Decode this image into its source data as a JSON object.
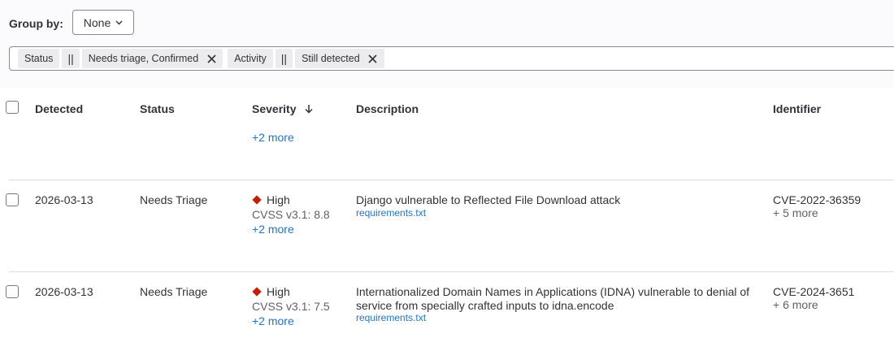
{
  "group_by": {
    "label": "Group by:",
    "value": "None"
  },
  "filters": {
    "tokens": [
      {
        "key": "Status",
        "operator": "||",
        "value": "Needs triage, Confirmed"
      },
      {
        "key": "Activity",
        "operator": "||",
        "value": "Still detected"
      }
    ]
  },
  "table": {
    "headers": {
      "detected": "Detected",
      "status": "Status",
      "severity": "Severity",
      "description": "Description",
      "identifier": "Identifier"
    },
    "partial_row": {
      "more": "+2 more"
    },
    "rows": [
      {
        "detected": "2026-03-13",
        "status": "Needs Triage",
        "severity": "High",
        "cvss": "CVSS v3.1: 8.8",
        "severity_more": "+2 more",
        "description": "Django vulnerable to Reflected File Download attack",
        "file": "requirements.txt",
        "identifier": "CVE-2022-36359",
        "identifier_more": "+ 5 more"
      },
      {
        "detected": "2026-03-13",
        "status": "Needs Triage",
        "severity": "High",
        "cvss": "CVSS v3.1: 7.5",
        "severity_more": "+2 more",
        "description": "Internationalized Domain Names in Applications (IDNA) vulnerable to denial of service from specially crafted inputs to idna.encode",
        "file": "requirements.txt",
        "identifier": "CVE-2024-3651",
        "identifier_more": "+ 6 more"
      }
    ]
  },
  "colors": {
    "severity_high": "#c91c00",
    "link": "#1f75cb"
  }
}
